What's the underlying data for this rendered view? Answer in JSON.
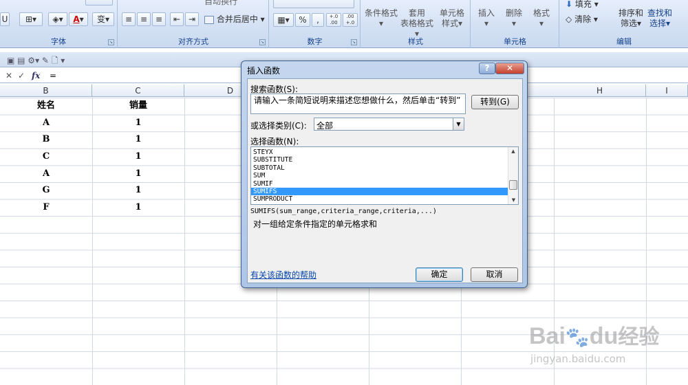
{
  "ribbon": {
    "groups": [
      {
        "label": "字体"
      },
      {
        "label": "对齐方式"
      },
      {
        "label": "数字"
      },
      {
        "label": "样式"
      },
      {
        "label": "单元格"
      },
      {
        "label": "编辑"
      }
    ],
    "font": {
      "bold_label": "U",
      "font_color_label": "A",
      "phonetic_label": "变"
    },
    "align": {
      "wrap_label": "自动换行",
      "merge_label": "合并后居中"
    },
    "number": {
      "percent_label": "%",
      "comma_label": ",",
      "inc_dec_label": "+.0 .00",
      "dec_dec_label": ".00 +.0"
    },
    "styles": {
      "cond_format_label": "条件格式",
      "table_format_label1": "套用",
      "table_format_label2": "表格格式",
      "cell_style_label1": "单元格",
      "cell_style_label2": "样式"
    },
    "cells": {
      "insert_label": "插入",
      "delete_label": "删除",
      "format_label": "格式"
    },
    "editing": {
      "fill_label": "填充",
      "clear_label": "清除",
      "sort_label1": "排序和",
      "sort_label2": "筛选",
      "find_label1": "查找和",
      "find_label2": "选择"
    }
  },
  "formula_bar": {
    "cancel": "✕",
    "enter": "✓",
    "fx": "fx",
    "content": "="
  },
  "columns": [
    "B",
    "C",
    "D",
    "H",
    "I"
  ],
  "table": {
    "headers": [
      "姓名",
      "销量"
    ],
    "rows": [
      [
        "A",
        "1"
      ],
      [
        "B",
        "1"
      ],
      [
        "C",
        "1"
      ],
      [
        "A",
        "1"
      ],
      [
        "G",
        "1"
      ],
      [
        "F",
        "1"
      ]
    ]
  },
  "dialog": {
    "title": "插入函数",
    "help_btn": "?",
    "close_btn": "✕",
    "search_label": "搜索函数(S):",
    "search_value": "请输入一条简短说明来描述您想做什么，然后单击“转到”",
    "go_button": "转到(G)",
    "category_label": "或选择类别(C):",
    "category_value": "全部",
    "select_label": "选择函数(N):",
    "functions": [
      "STEYX",
      "SUBSTITUTE",
      "SUBTOTAL",
      "SUM",
      "SUMIF",
      "SUMIFS",
      "SUMPRODUCT"
    ],
    "selected_function": "SUMIFS",
    "syntax": "SUMIFS(sum_range,criteria_range,criteria,...)",
    "description": "对一组给定条件指定的单元格求和",
    "help_link": "有关该函数的帮助",
    "ok_button": "确定",
    "cancel_button": "取消"
  },
  "watermark": {
    "brand": "Bai",
    "brand2": "du",
    "brand3": "经验",
    "url": "jingyan.baidu.com"
  }
}
